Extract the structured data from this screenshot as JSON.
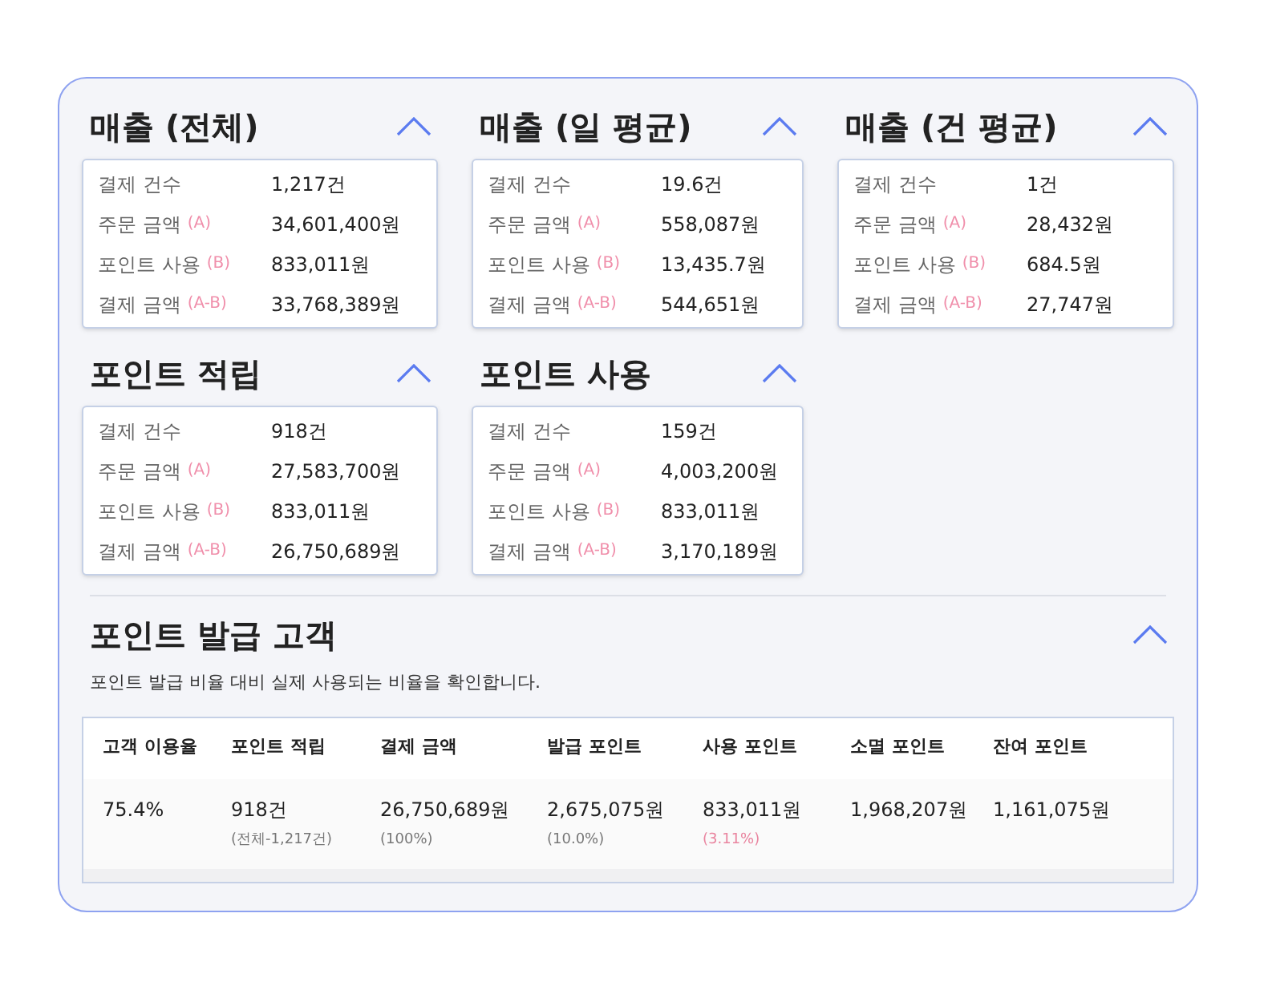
{
  "cards": [
    {
      "title": "매출 (전체)",
      "expanded": true,
      "rows": [
        {
          "label": "결제 건수",
          "value": "1,217건"
        },
        {
          "label": "주문 금액",
          "tag": "(A)",
          "value": "34,601,400원"
        },
        {
          "label": "포인트 사용",
          "tag": "(B)",
          "value": "833,011원"
        },
        {
          "label": "결제 금액",
          "tag": "(A-B)",
          "value": "33,768,389원"
        }
      ]
    },
    {
      "title": "매출 (일 평균)",
      "expanded": true,
      "rows": [
        {
          "label": "결제 건수",
          "value": "19.6건"
        },
        {
          "label": "주문 금액",
          "tag": "(A)",
          "value": "558,087원"
        },
        {
          "label": "포인트 사용",
          "tag": "(B)",
          "value": "13,435.7원"
        },
        {
          "label": "결제 금액",
          "tag": "(A-B)",
          "value": "544,651원"
        }
      ]
    },
    {
      "title": "매출 (건 평균)",
      "expanded": true,
      "rows": [
        {
          "label": "결제 건수",
          "value": "1건"
        },
        {
          "label": "주문 금액",
          "tag": "(A)",
          "value": "28,432원"
        },
        {
          "label": "포인트 사용",
          "tag": "(B)",
          "value": "684.5원"
        },
        {
          "label": "결제 금액",
          "tag": "(A-B)",
          "value": "27,747원"
        }
      ]
    },
    {
      "title": "포인트 적립",
      "expanded": true,
      "rows": [
        {
          "label": "결제 건수",
          "value": "918건"
        },
        {
          "label": "주문 금액",
          "tag": "(A)",
          "value": "27,583,700원"
        },
        {
          "label": "포인트 사용",
          "tag": "(B)",
          "value": "833,011원"
        },
        {
          "label": "결제 금액",
          "tag": "(A-B)",
          "value": "26,750,689원"
        }
      ]
    },
    {
      "title": "포인트 사용",
      "expanded": true,
      "rows": [
        {
          "label": "결제 건수",
          "value": "159건"
        },
        {
          "label": "주문 금액",
          "tag": "(A)",
          "value": "4,003,200원"
        },
        {
          "label": "포인트 사용",
          "tag": "(B)",
          "value": "833,011원"
        },
        {
          "label": "결제 금액",
          "tag": "(A-B)",
          "value": "3,170,189원"
        }
      ]
    }
  ],
  "issuance": {
    "title": "포인트 발급 고객",
    "expanded": true,
    "description": "포인트 발급 비율 대비 실제 사용되는 비율을 확인합니다.",
    "table": {
      "columns": [
        "고객 이용율",
        "포인트 적립",
        "결제 금액",
        "발급 포인트",
        "사용 포인트",
        "소멸 포인트",
        "잔여 포인트"
      ],
      "row": [
        {
          "value": "75.4%"
        },
        {
          "value": "918건",
          "sub": "(전체-1,217건)",
          "color": "#777777"
        },
        {
          "value": "26,750,689원",
          "sub": "(100%)",
          "color": "#777777"
        },
        {
          "value": "2,675,075원",
          "sub": "(10.0%)",
          "color": "#777777"
        },
        {
          "value": "833,011원",
          "sub": "(3.11%)",
          "color": "#e9849f"
        },
        {
          "value": "1,968,207원"
        },
        {
          "value": "1,161,075원"
        }
      ]
    }
  }
}
